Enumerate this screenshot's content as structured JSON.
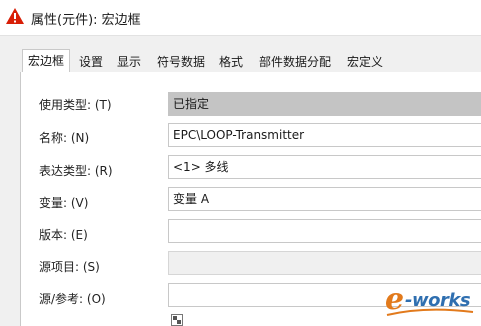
{
  "window": {
    "title": "属性(元件): 宏边框",
    "warning_icon_color": "#d81e06"
  },
  "tabs": [
    {
      "label": "宏边框",
      "active": true
    },
    {
      "label": "设置",
      "active": false
    },
    {
      "label": "显示",
      "active": false
    },
    {
      "label": "符号数据",
      "active": false
    },
    {
      "label": "格式",
      "active": false
    },
    {
      "label": "部件数据分配",
      "active": false
    },
    {
      "label": "宏定义",
      "active": false
    }
  ],
  "properties": [
    {
      "label": "使用类型: (T)",
      "value": "已指定",
      "state": "disabled"
    },
    {
      "label": "名称: (N)",
      "value": "EPC\\LOOP-Transmitter",
      "state": "editable"
    },
    {
      "label": "表达类型: (R)",
      "value": "<1> 多线",
      "state": "editable"
    },
    {
      "label": "变量: (V)",
      "value": "变量 A",
      "state": "editable"
    },
    {
      "label": "版本: (E)",
      "value": "",
      "state": "editable"
    },
    {
      "label": "源项目: (S)",
      "value": "",
      "state": "readonly"
    },
    {
      "label": "源/参考: (O)",
      "value": "",
      "state": "editable"
    }
  ],
  "watermark": {
    "brand": "e-works",
    "colors": {
      "e": "#e27a1c",
      "text": "#2f6fb0"
    }
  }
}
